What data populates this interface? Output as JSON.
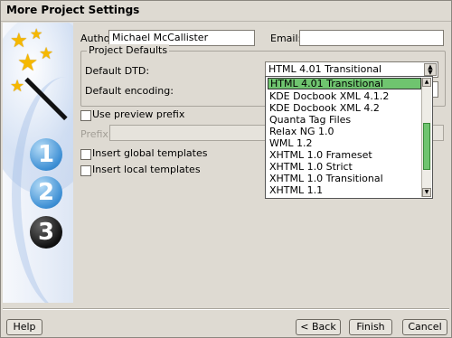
{
  "window": {
    "title": "More Project Settings"
  },
  "steps": [
    "1",
    "2",
    "3"
  ],
  "author": {
    "label": "Author:",
    "value": "Michael McCallister"
  },
  "email": {
    "label": "Email:",
    "value": ""
  },
  "project_defaults": {
    "legend": "Project Defaults",
    "dtd_label": "Default DTD:",
    "dtd_value": "HTML 4.01 Transitional",
    "encoding_label": "Default encoding:"
  },
  "dtd_options": [
    "HTML 4.01 Transitional",
    "KDE Docbook XML 4.1.2",
    "KDE Docbook XML 4.2",
    "Quanta Tag Files",
    "Relax NG 1.0",
    "WML 1.2",
    "XHTML 1.0 Frameset",
    "XHTML 1.0 Strict",
    "XHTML 1.0 Transitional",
    "XHTML 1.1"
  ],
  "preview_prefix": {
    "label": "Use preview prefix",
    "prefix_label": "Prefix:"
  },
  "global_templates": {
    "label": "Insert global templates"
  },
  "local_templates": {
    "label": "Insert local templates"
  },
  "buttons": {
    "help": "Help",
    "back": "< Back",
    "finish": "Finish",
    "cancel": "Cancel"
  },
  "colors": {
    "selection": "#6fc46f",
    "step_active": "#3d8fd4",
    "step_current": "#111111"
  }
}
